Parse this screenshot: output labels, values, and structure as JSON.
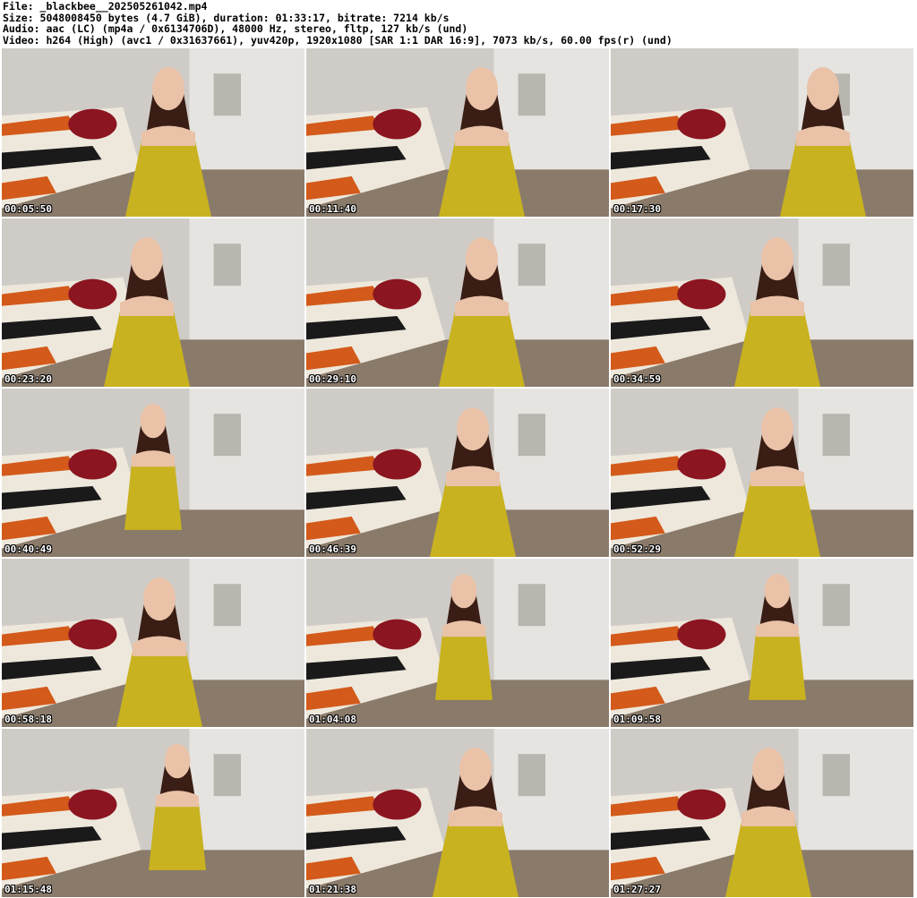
{
  "header": {
    "line1": "File: _blackbee__202505261042.mp4",
    "line2": "Size: 5048008450 bytes (4.7 GiB), duration: 01:33:17, bitrate: 7214 kb/s",
    "line3": "Audio: aac (LC) (mp4a / 0x6134706D), 48000 Hz, stereo, fltp, 127 kb/s (und)",
    "line4": "Video: h264 (High) (avc1 / 0x31637661), yuv420p, 1920x1080 [SAR 1:1 DAR 16:9], 7073 kb/s, 60.00 fps(r) (und)"
  },
  "thumbnails": [
    {
      "timestamp": "00:05:50"
    },
    {
      "timestamp": "00:11:40"
    },
    {
      "timestamp": "00:17:30"
    },
    {
      "timestamp": "00:23:20"
    },
    {
      "timestamp": "00:29:10"
    },
    {
      "timestamp": "00:34:59"
    },
    {
      "timestamp": "00:40:49"
    },
    {
      "timestamp": "00:46:39"
    },
    {
      "timestamp": "00:52:29"
    },
    {
      "timestamp": "00:58:18"
    },
    {
      "timestamp": "01:04:08"
    },
    {
      "timestamp": "01:09:58"
    },
    {
      "timestamp": "01:15:48"
    },
    {
      "timestamp": "01:21:38"
    },
    {
      "timestamp": "01:27:27"
    }
  ],
  "colors": {
    "wall": "#cfccc8",
    "floor": "#8a7a6a",
    "dress": "#c9b21f",
    "hair": "#3a1d14",
    "sofa_orange": "#d35a1a",
    "sofa_black": "#1a1a1a",
    "cushion_red": "#8b1520",
    "skin": "#e9c2a8"
  }
}
